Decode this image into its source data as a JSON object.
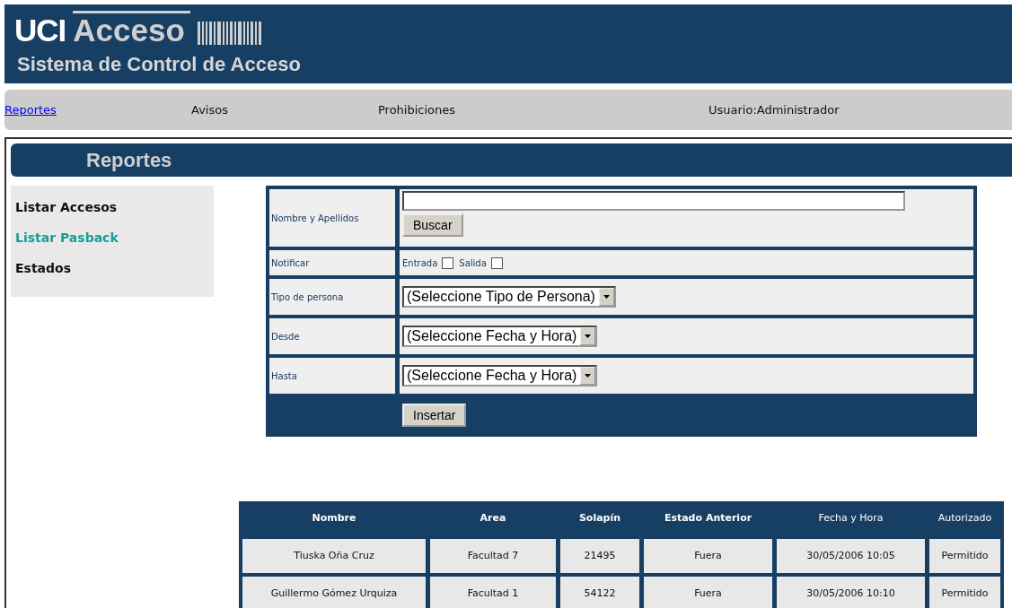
{
  "header": {
    "brand": "UCI",
    "product": "Acceso",
    "subtitle": "Sistema de Control de Acceso"
  },
  "nav": {
    "items": [
      {
        "label": "Reportes",
        "kind": "link"
      },
      {
        "label": "Avisos",
        "kind": "text"
      },
      {
        "label": "Prohibiciones",
        "kind": "text"
      }
    ],
    "user": "Usuario:Administrador"
  },
  "section_title": "Reportes",
  "sidebar": {
    "items": [
      {
        "label": "Listar Accesos",
        "selected": false
      },
      {
        "label": "Listar Pasback",
        "selected": true
      },
      {
        "label": "Estados",
        "selected": false
      }
    ]
  },
  "form": {
    "rows": [
      {
        "label": "Nombre y Apellidos",
        "kind": "search",
        "button": "Buscar"
      },
      {
        "label": "Notificar",
        "kind": "checks",
        "options": [
          {
            "label": "Entrada",
            "checked": false
          },
          {
            "label": "Salida",
            "checked": false
          }
        ]
      },
      {
        "label": "Tipo de persona",
        "kind": "select",
        "value": "(Seleccione Tipo de Persona)"
      },
      {
        "label": "Desde",
        "kind": "select",
        "value": "(Seleccione Fecha y Hora)"
      },
      {
        "label": "Hasta",
        "kind": "select",
        "value": "(Seleccione Fecha y Hora)"
      }
    ],
    "submit": "Insertar"
  },
  "table": {
    "columns": [
      {
        "label": "Nombre",
        "bold": true
      },
      {
        "label": "Area",
        "bold": true
      },
      {
        "label": "Solapín",
        "bold": true
      },
      {
        "label": "Estado Anterior",
        "bold": true
      },
      {
        "label": "Fecha y Hora",
        "bold": false
      },
      {
        "label": "Autorizado",
        "bold": false
      }
    ],
    "rows": [
      [
        "Tiuska Oña Cruz",
        "Facultad 7",
        "21495",
        "Fuera",
        "30/05/2006 10:05",
        "Permitido"
      ],
      [
        "Guillermo Gómez Urquiza",
        "Facultad 1",
        "54122",
        "Fuera",
        "30/05/2006 10:10",
        "Permitido"
      ]
    ]
  }
}
